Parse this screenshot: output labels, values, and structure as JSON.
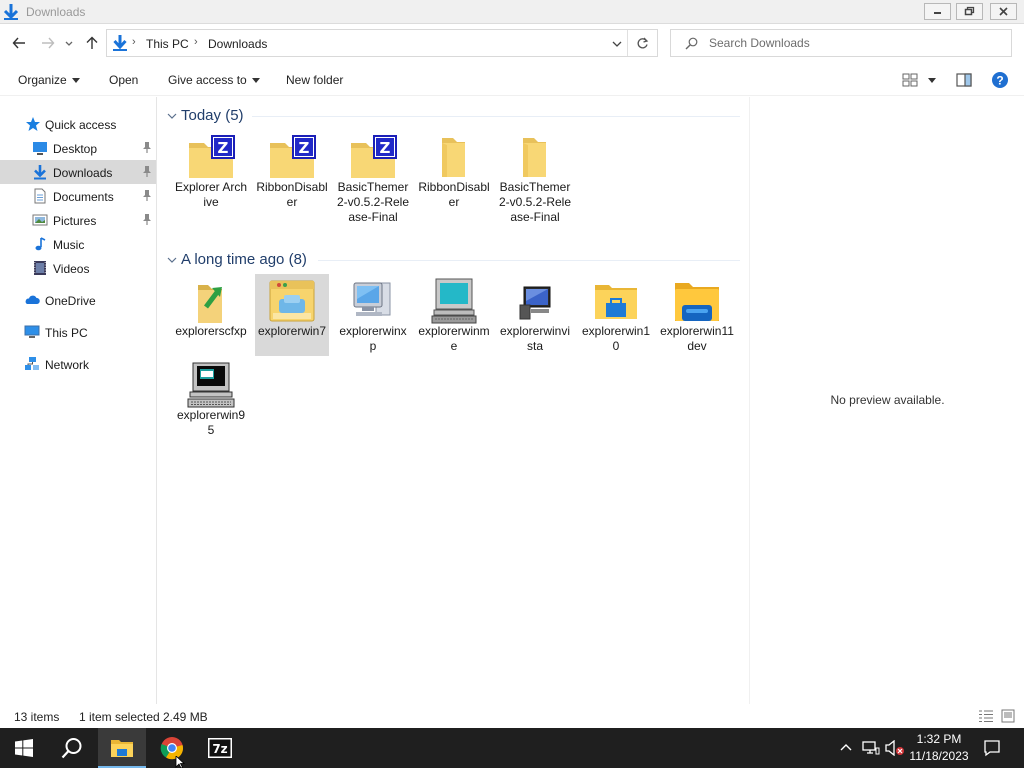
{
  "window": {
    "title": "Downloads"
  },
  "address": {
    "crumbs": [
      "This PC",
      "Downloads"
    ]
  },
  "search": {
    "placeholder": "Search Downloads"
  },
  "commands": {
    "organize": "Organize",
    "open": "Open",
    "give_access": "Give access to",
    "new_folder": "New folder"
  },
  "nav": {
    "quick_access": "Quick access",
    "desktop": "Desktop",
    "downloads": "Downloads",
    "documents": "Documents",
    "pictures": "Pictures",
    "music": "Music",
    "videos": "Videos",
    "onedrive": "OneDrive",
    "this_pc": "This PC",
    "network": "Network"
  },
  "groups": [
    {
      "title": "Today (5)",
      "items": [
        {
          "label": "Explorer Archive",
          "icon": "zip-folder-icon"
        },
        {
          "label": "RibbonDisabler",
          "icon": "zip-folder-icon"
        },
        {
          "label": "BasicThemer2-v0.5.2-Release-Final",
          "icon": "zip-folder-icon"
        },
        {
          "label": "RibbonDisabler",
          "icon": "folder-icon"
        },
        {
          "label": "BasicThemer2-v0.5.2-Release-Final",
          "icon": "folder-icon"
        }
      ]
    },
    {
      "title": "A long time ago (8)",
      "items": [
        {
          "label": "explorerscfxp",
          "icon": "folder-arrow-icon"
        },
        {
          "label": "explorerwin7",
          "icon": "win7-explorer-icon",
          "selected": true
        },
        {
          "label": "explorerwinxp",
          "icon": "computer-xp-icon"
        },
        {
          "label": "explorerwinme",
          "icon": "computer-me-icon"
        },
        {
          "label": "explorerwinvista",
          "icon": "computer-vista-icon"
        },
        {
          "label": "explorerwin10",
          "icon": "win10-explorer-icon"
        },
        {
          "label": "explorerwin11dev",
          "icon": "win11-explorer-icon"
        },
        {
          "label": "explorerwin95",
          "icon": "computer-95-icon"
        }
      ]
    }
  ],
  "preview": {
    "text": "No preview available."
  },
  "status": {
    "count": "13 items",
    "selected": "1 item selected",
    "size": "2.49 MB"
  },
  "taskbar": {
    "time": "1:32 PM",
    "date": "11/18/2023"
  },
  "colors": {
    "accent": "#0078d7",
    "taskbar": "#1f1f1f",
    "selection": "#d9d9d9",
    "group_title": "#213e6b",
    "folder": "#f8d775"
  }
}
